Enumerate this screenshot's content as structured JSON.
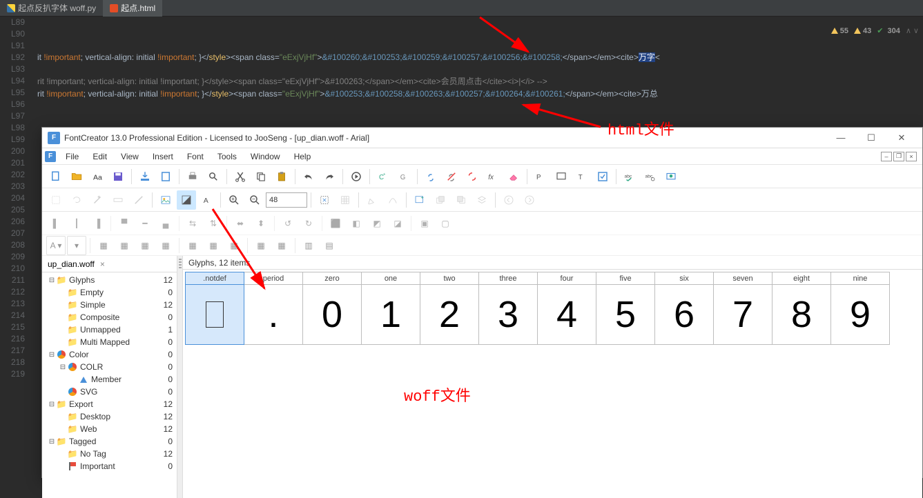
{
  "editor": {
    "tabs": [
      {
        "label": "起点反扒字体 woff.py",
        "kind": "py"
      },
      {
        "label": "起点.html",
        "kind": "html",
        "active": true
      }
    ],
    "line_numbers": [
      "L89",
      "L90",
      "L91",
      "L92",
      "L93",
      "L94",
      "L95",
      "L96",
      "L97",
      "L98",
      "L99",
      "200",
      "201",
      "202",
      "203",
      "204",
      "205",
      "206",
      "207",
      "208",
      "209",
      "210",
      "211",
      "212",
      "213",
      "214",
      "215",
      "216",
      "217",
      "218",
      "219"
    ],
    "line91_a": "it ",
    "line91_imp": "!important",
    "line91_b": "; vertical-align: initial ",
    "line91_c": "; }</",
    "line91_style": "style",
    "line91_d": "><span class=",
    "line91_cls": "\"eExjVjHf\"",
    "line91_e": ">",
    "line91_codes": "&#100260;&#100253;&#100259;&#100257;&#100256;&#100258;",
    "line91_f": "</span></em><cite>",
    "line91_hl": "万字",
    "line91_g": "<",
    "line93_a": "rit ",
    "line93_b": "; vertical-align: initial ",
    "line93_c": "; }</style><span class=",
    "line93_d": ">",
    "line93_codes": "&#100263;",
    "line93_e": "</span></em><cite>会员周点击</cite><i>|</i> -->",
    "line94_a": "rit ",
    "line94_b": "; vertical-align: initial ",
    "line94_c": "; }</",
    "line94_d": "><span class=",
    "line94_e": ">",
    "line94_codes": "&#100253;&#100258;&#100263;&#100257;&#100264;&#100261;",
    "line94_f": "</span></em><cite>万总",
    "warn_a": "55",
    "warn_b": "43",
    "warn_c": "304"
  },
  "annot": {
    "html": "html文件",
    "woff": "woff文件"
  },
  "fc": {
    "title": "FontCreator 13.0 Professional Edition - Licensed to JooSeng - [up_dian.woff - Arial]",
    "title_icon": "F",
    "menu": [
      "File",
      "Edit",
      "View",
      "Insert",
      "Font",
      "Tools",
      "Window",
      "Help"
    ],
    "toolbar_num": "48",
    "sidebar_tab": "up_dian.woff",
    "main_header": "Glyphs, 12 items",
    "tree": [
      {
        "indent": 0,
        "exp": "⊟",
        "ico": "folder",
        "label": "Glyphs",
        "count": "12"
      },
      {
        "indent": 1,
        "exp": "",
        "ico": "folder",
        "label": "Empty",
        "count": "0"
      },
      {
        "indent": 1,
        "exp": "",
        "ico": "folder",
        "label": "Simple",
        "count": "12"
      },
      {
        "indent": 1,
        "exp": "",
        "ico": "folder",
        "label": "Composite",
        "count": "0"
      },
      {
        "indent": 1,
        "exp": "",
        "ico": "folder",
        "label": "Unmapped",
        "count": "1"
      },
      {
        "indent": 1,
        "exp": "",
        "ico": "folder",
        "label": "Multi Mapped",
        "count": "0"
      },
      {
        "indent": 0,
        "exp": "⊟",
        "ico": "pie",
        "label": "Color",
        "count": "0"
      },
      {
        "indent": 1,
        "exp": "⊟",
        "ico": "pie",
        "label": "COLR",
        "count": "0"
      },
      {
        "indent": 2,
        "exp": "",
        "ico": "tri",
        "label": "Member",
        "count": "0"
      },
      {
        "indent": 1,
        "exp": "",
        "ico": "pie",
        "label": "SVG",
        "count": "0"
      },
      {
        "indent": 0,
        "exp": "⊟",
        "ico": "folder",
        "label": "Export",
        "count": "12"
      },
      {
        "indent": 1,
        "exp": "",
        "ico": "folder",
        "label": "Desktop",
        "count": "12"
      },
      {
        "indent": 1,
        "exp": "",
        "ico": "folder",
        "label": "Web",
        "count": "12"
      },
      {
        "indent": 0,
        "exp": "⊟",
        "ico": "folder",
        "label": "Tagged",
        "count": "0"
      },
      {
        "indent": 1,
        "exp": "",
        "ico": "folder",
        "label": "No Tag",
        "count": "12"
      },
      {
        "indent": 1,
        "exp": "",
        "ico": "flag",
        "label": "Important",
        "count": "0"
      }
    ],
    "glyphs": [
      {
        "name": ".notdef",
        "char": "",
        "sel": true,
        "notdef": true
      },
      {
        "name": "period",
        "char": "."
      },
      {
        "name": "zero",
        "char": "0"
      },
      {
        "name": "one",
        "char": "1"
      },
      {
        "name": "two",
        "char": "2"
      },
      {
        "name": "three",
        "char": "3"
      },
      {
        "name": "four",
        "char": "4"
      },
      {
        "name": "five",
        "char": "5"
      },
      {
        "name": "six",
        "char": "6"
      },
      {
        "name": "seven",
        "char": "7"
      },
      {
        "name": "eight",
        "char": "8"
      },
      {
        "name": "nine",
        "char": "9"
      }
    ]
  }
}
